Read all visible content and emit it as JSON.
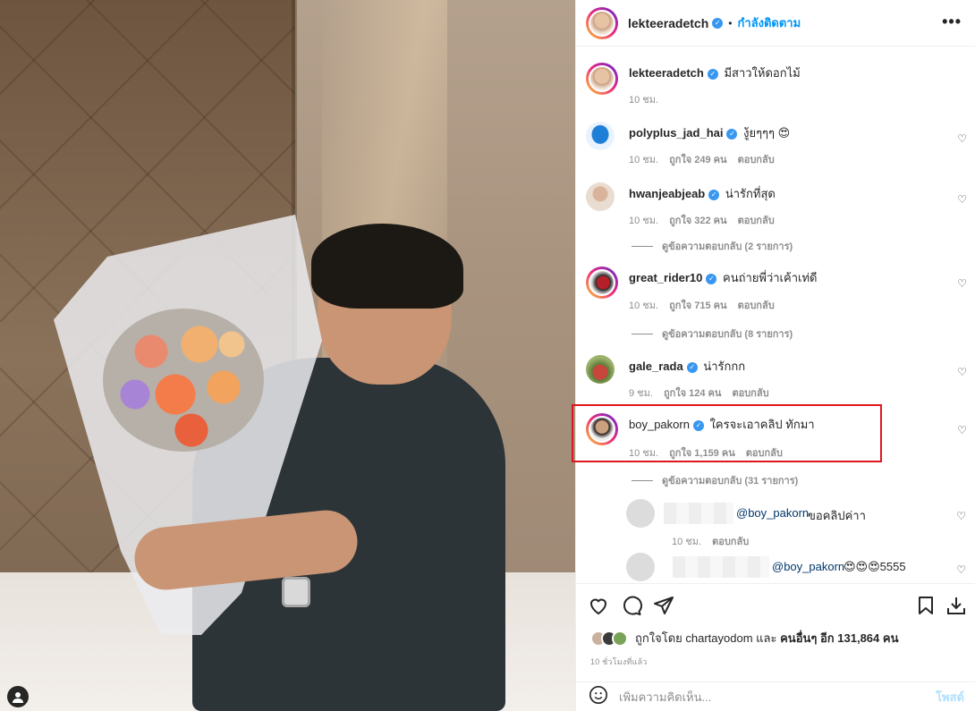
{
  "post": {
    "author": "lekteeradetch",
    "follow_status": "กำลังติดตาม",
    "more_icon": "•••"
  },
  "caption": {
    "username": "lekteeradetch",
    "text": "มีสาวให้ดอกไม้",
    "time": "10 ชม."
  },
  "comments": [
    {
      "username": "polyplus_jad_hai",
      "text": "งู้ยๆๆๆ 😍",
      "time": "10 ชม.",
      "likes": "ถูกใจ 249 คน",
      "reply": "ตอบกลับ"
    },
    {
      "username": "hwanjeabjeab",
      "text": "น่ารักที่สุด",
      "time": "10 ชม.",
      "likes": "ถูกใจ 322 คน",
      "reply": "ตอบกลับ",
      "view_replies": "ดูข้อความตอบกลับ (2 รายการ)"
    },
    {
      "username": "great_rider10",
      "text": "คนถ่ายพี่ว่าเค้าเท่ดี",
      "time": "10 ชม.",
      "likes": "ถูกใจ 715 คน",
      "reply": "ตอบกลับ",
      "view_replies": "ดูข้อความตอบกลับ (8 รายการ)"
    },
    {
      "username": "gale_rada",
      "text": "น่ารักกก",
      "time": "9 ชม.",
      "likes": "ถูกใจ 124 คน",
      "reply": "ตอบกลับ"
    },
    {
      "username": "boy_pakorn",
      "text": "ใครจะเอาคลิป ทักมา",
      "time": "10 ชม.",
      "likes": "ถูกใจ 1,159 คน",
      "reply": "ตอบกลับ",
      "view_replies": "ดูข้อความตอบกลับ (31 รายการ)"
    }
  ],
  "replies": [
    {
      "mention": "@boy_pakorn",
      "text": "ขอคลิปค่าา",
      "time": "10 ชม.",
      "reply": "ตอบกลับ"
    },
    {
      "mention": "@boy_pakorn",
      "text": "😍😍😍5555"
    }
  ],
  "likes_summary": {
    "prefix": "ถูกใจโดย",
    "first_user": "chartayodom",
    "joiner": "และ",
    "others": "คนอื่นๆ อีก 131,864 คน"
  },
  "time_ago": "10 ชั่วโมงที่แล้ว",
  "add_comment": {
    "placeholder": "เพิ่มความคิดเห็น...",
    "post_label": "โพสต์"
  },
  "icons": {
    "heart": "♡",
    "verified": "✓",
    "user": "👤",
    "emoji": "☺"
  },
  "colors": {
    "accent": "#0095f6",
    "highlight": "#e0161d",
    "verified": "#3897f0"
  }
}
